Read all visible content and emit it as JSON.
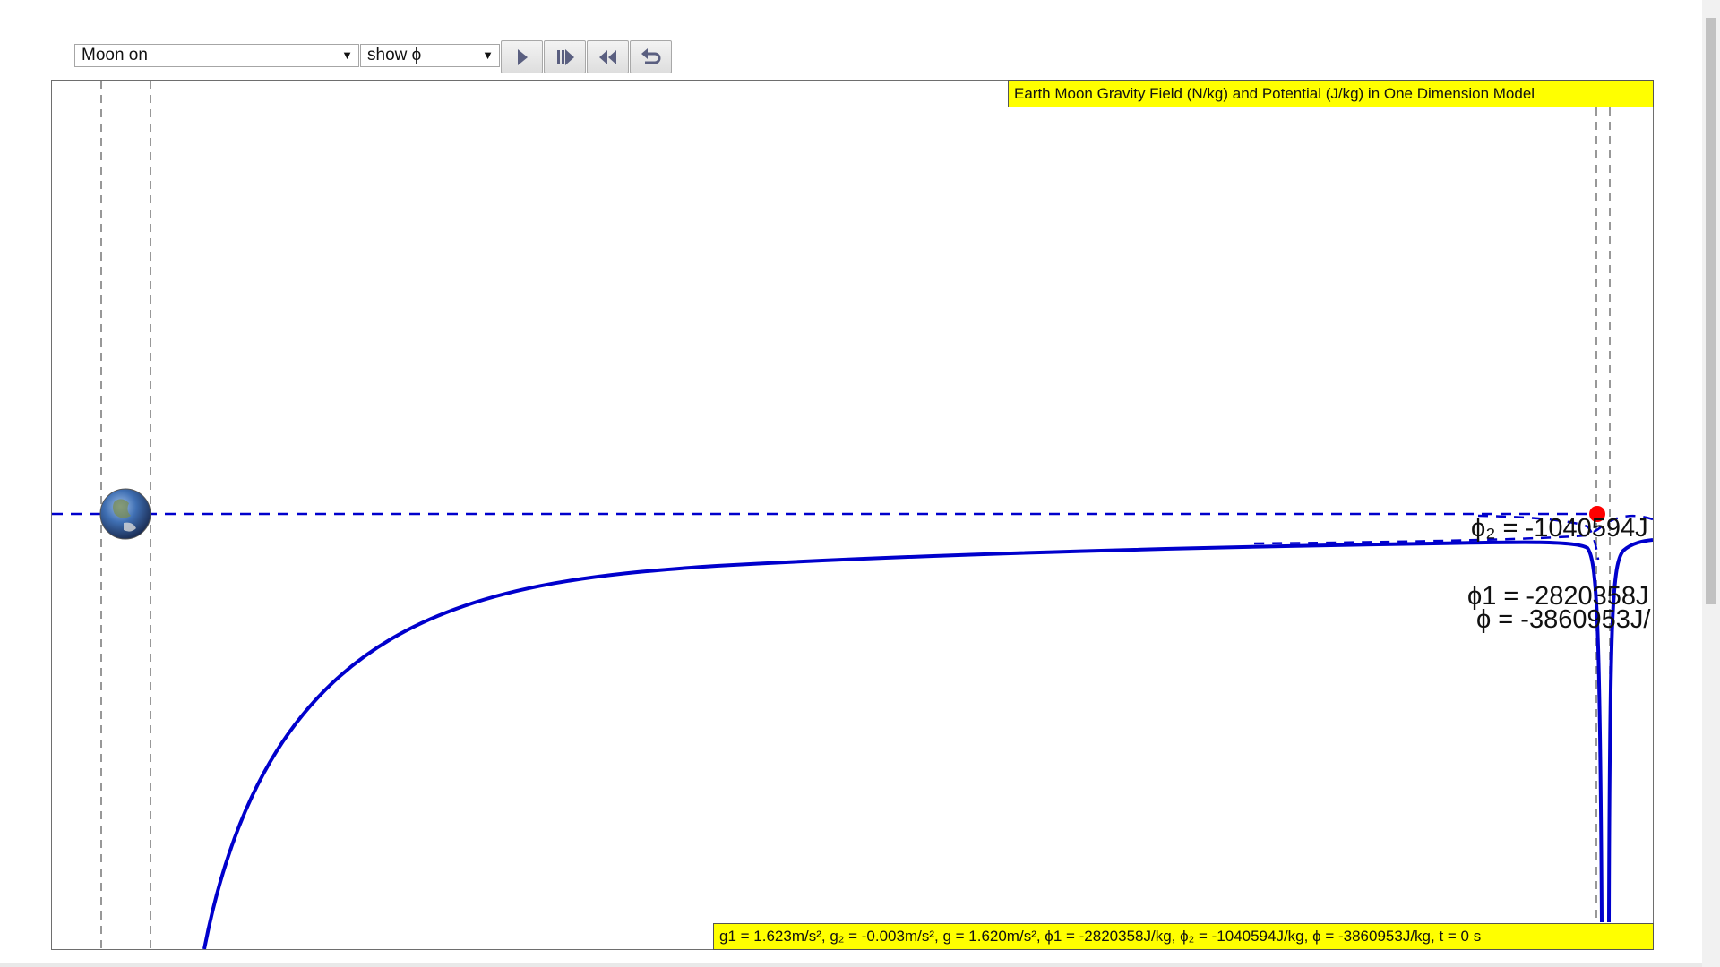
{
  "controls": {
    "moon_select": {
      "value": "Moon on",
      "arrow": "▼"
    },
    "display_select": {
      "value": "show ϕ",
      "arrow": "▼"
    },
    "buttons": [
      {
        "name": "play-button",
        "icon": "play-icon"
      },
      {
        "name": "step-forward-button",
        "icon": "step-forward-icon"
      },
      {
        "name": "rewind-button",
        "icon": "rewind-icon"
      },
      {
        "name": "reset-button",
        "icon": "reset-icon"
      }
    ]
  },
  "chart": {
    "title": "Earth Moon Gravity Field (N/kg) and Potential (J/kg) in One Dimension Model",
    "labels": {
      "phi2": "ϕ₂ = -1040594J",
      "phi1": "ϕ1 = -2820358J",
      "phi": "ϕ = -3860953J/"
    },
    "status": "g1 = 1.623m/s², g₂ = -0.003m/s², g = 1.620m/s², ϕ1 = -2820358J/kg, ϕ₂ = -1040594J/kg, ϕ = -3860953J/kg, t = 0 s",
    "colors": {
      "curve": "#0000cc",
      "marker": "#ff0000",
      "highlight": "#ffff00"
    }
  },
  "chart_data": {
    "type": "line",
    "title": "Earth Moon Gravity Field (N/kg) and Potential (J/kg) in One Dimension Model",
    "series": [
      {
        "name": "ϕ",
        "style": "solid"
      },
      {
        "name": "ϕ1",
        "style": "dashed"
      },
      {
        "name": "ϕ₂",
        "style": "dashed"
      }
    ],
    "values": {
      "g1": "1.623m/s²",
      "g2": "-0.003m/s²",
      "g": "1.620m/s²",
      "phi1": "-2820358J/kg",
      "phi2": "-1040594J/kg",
      "phi": "-3860953J/kg",
      "t": "0 s"
    },
    "grid": false
  }
}
